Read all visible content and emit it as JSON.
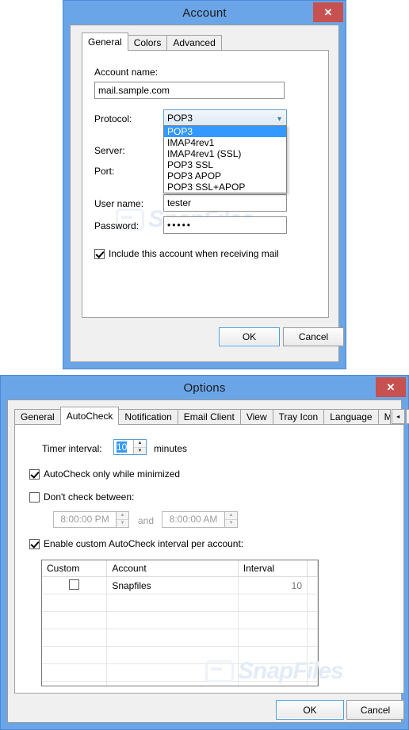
{
  "account_window": {
    "title": "Account",
    "close_label": "✕",
    "tabs": [
      {
        "label": "General",
        "active": true
      },
      {
        "label": "Colors",
        "active": false
      },
      {
        "label": "Advanced",
        "active": false
      }
    ],
    "fields": {
      "account_name_label": "Account name:",
      "account_name_value": "mail.sample.com",
      "protocol_label": "Protocol:",
      "protocol_value": "POP3",
      "server_label": "Server:",
      "port_label": "Port:",
      "username_label": "User name:",
      "username_value": "tester",
      "password_label": "Password:",
      "password_value": "•••••"
    },
    "protocol_options": [
      {
        "label": "POP3",
        "selected": true
      },
      {
        "label": "IMAP4rev1",
        "selected": false
      },
      {
        "label": "IMAP4rev1 (SSL)",
        "selected": false
      },
      {
        "label": "POP3 SSL",
        "selected": false
      },
      {
        "label": "POP3 APOP",
        "selected": false
      },
      {
        "label": "POP3 SSL+APOP",
        "selected": false
      }
    ],
    "include_checkbox": {
      "label": "Include this account when receiving mail",
      "checked": true
    },
    "buttons": {
      "ok": "OK",
      "cancel": "Cancel"
    },
    "watermark": "SnapFiles"
  },
  "options_window": {
    "title": "Options",
    "close_label": "✕",
    "tabs": [
      {
        "label": "General",
        "active": false
      },
      {
        "label": "AutoCheck",
        "active": true
      },
      {
        "label": "Notification",
        "active": false
      },
      {
        "label": "Email Client",
        "active": false
      },
      {
        "label": "View",
        "active": false
      },
      {
        "label": "Tray Icon",
        "active": false
      },
      {
        "label": "Language",
        "active": false
      },
      {
        "label": "Mouse A",
        "active": false
      }
    ],
    "tab_scroll": {
      "left": "◂",
      "right": "▸"
    },
    "autocheck": {
      "timer_interval_label": "Timer interval:",
      "timer_interval_value": "10",
      "minutes_label": "minutes",
      "only_minimized": {
        "label": "AutoCheck only while minimized",
        "checked": true
      },
      "dont_check": {
        "label": "Don't check between:",
        "checked": false
      },
      "time_from": "8:00:00 PM",
      "and_label": "and",
      "time_to": "8:00:00 AM",
      "enable_custom": {
        "label": "Enable custom AutoCheck interval per account:",
        "checked": true
      }
    },
    "grid": {
      "columns": [
        "Custom",
        "Account",
        "Interval",
        ""
      ],
      "rows": [
        {
          "custom": false,
          "account": "Snapfiles",
          "interval": "10"
        }
      ]
    },
    "buttons": {
      "ok": "OK",
      "cancel": "Cancel"
    },
    "watermark": "SnapFiles"
  },
  "colors": {
    "titlebar": "#6aa5e8",
    "close": "#c75050",
    "selection": "#3399ff",
    "dialog_face": "#f0f0f0"
  }
}
